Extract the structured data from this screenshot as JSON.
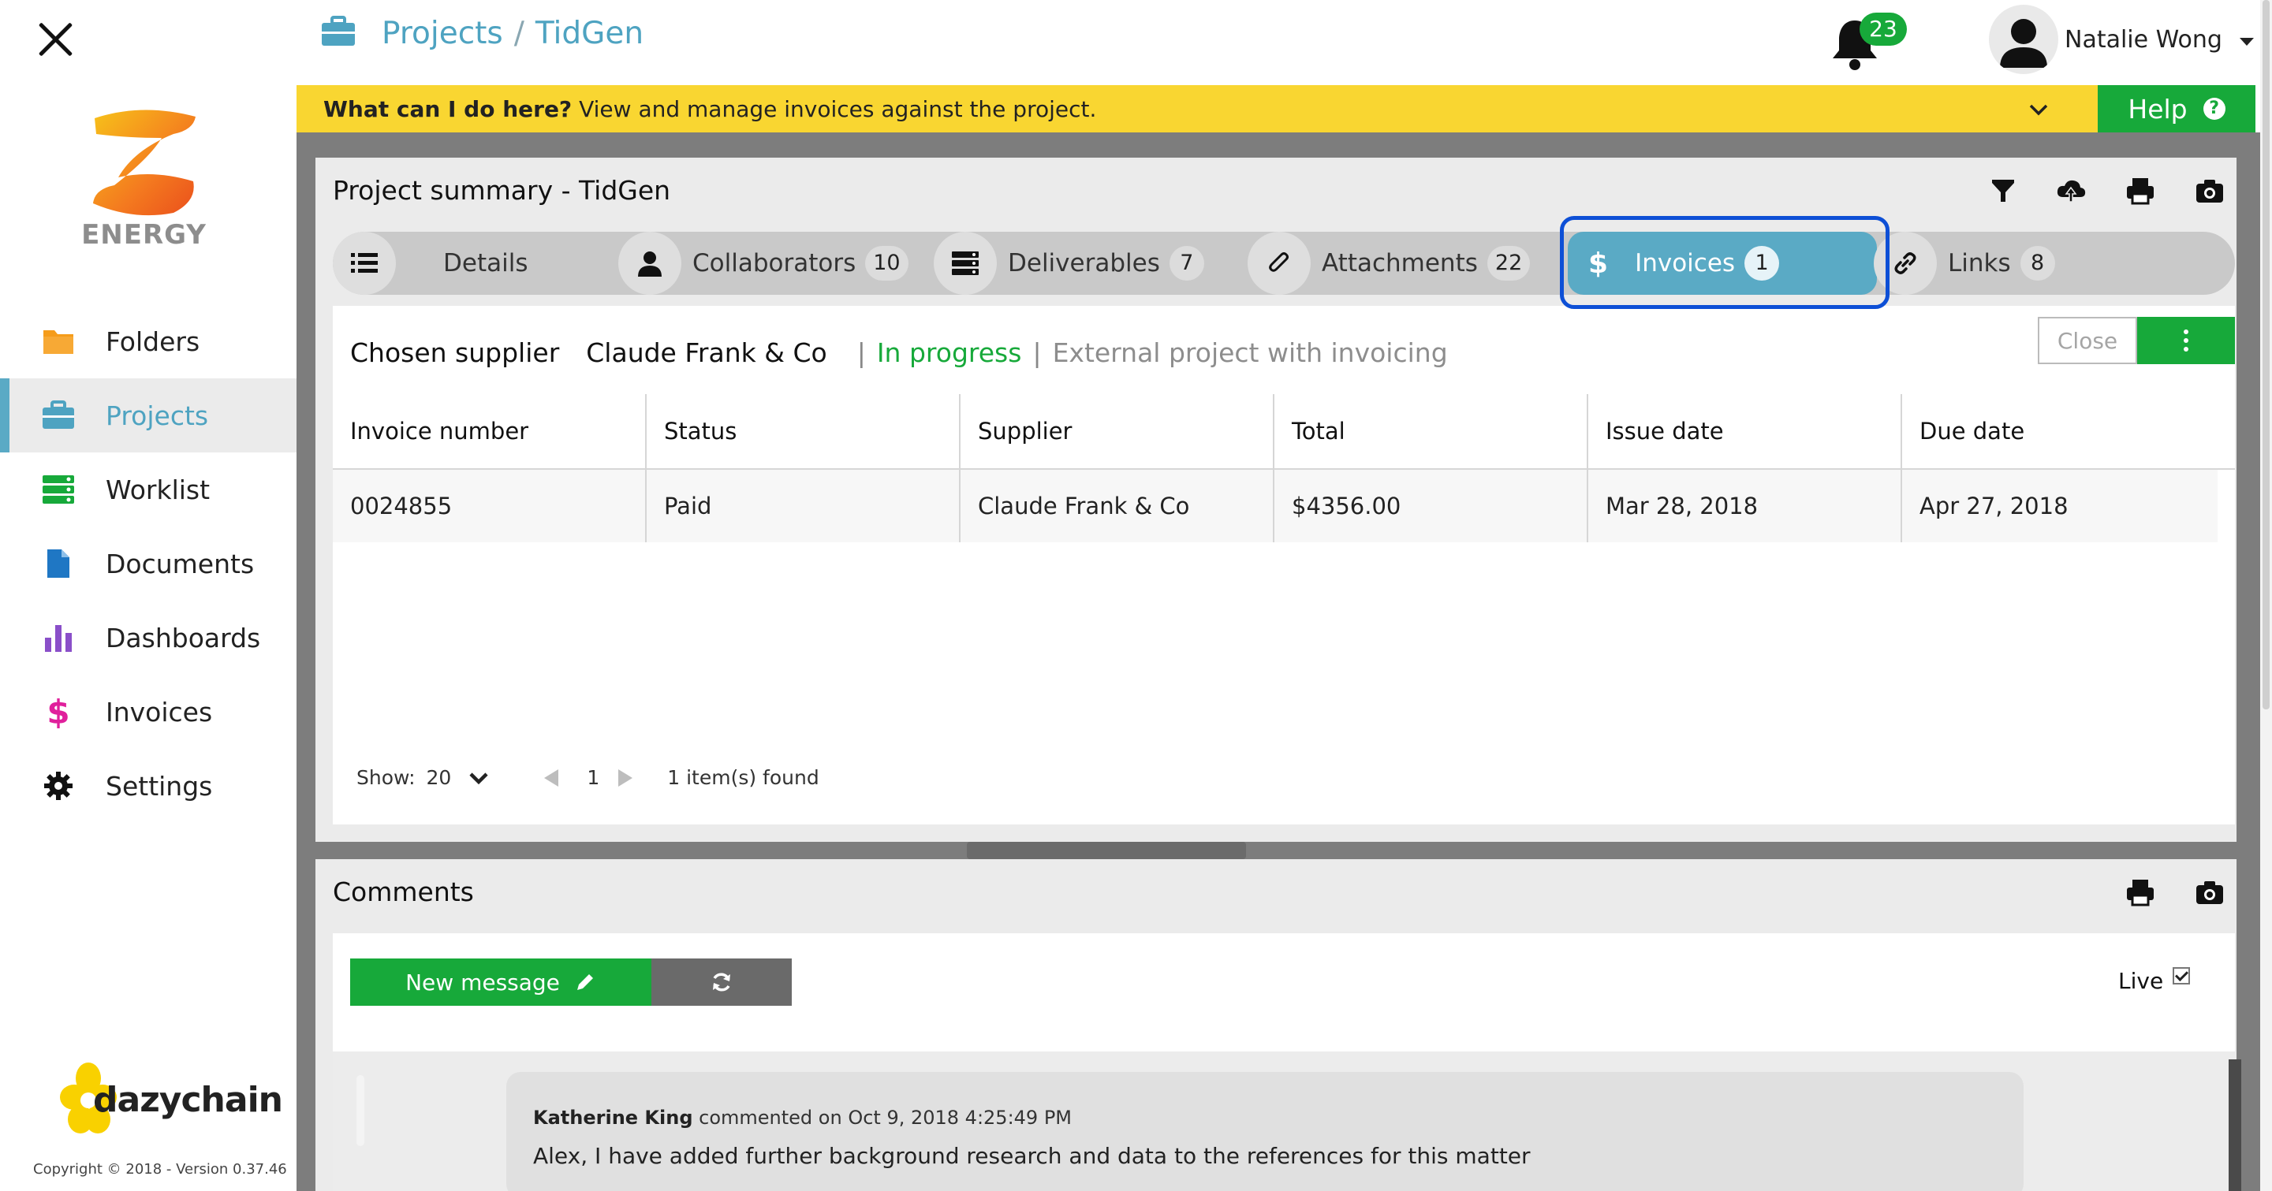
{
  "app": {
    "company_logo_text": "ENERGY",
    "brand_name": "dazychain",
    "copyright": "Copyright © 2018 - Version 0.37.46"
  },
  "sidebar": {
    "items": [
      {
        "label": "Folders",
        "icon": "folder-icon",
        "color": "#f59c1a",
        "active": false
      },
      {
        "label": "Projects",
        "icon": "briefcase-icon",
        "color": "#4ea3c1",
        "active": true
      },
      {
        "label": "Worklist",
        "icon": "list-icon",
        "color": "#17a93a",
        "active": false
      },
      {
        "label": "Documents",
        "icon": "document-icon",
        "color": "#1f77c4",
        "active": false
      },
      {
        "label": "Dashboards",
        "icon": "bar-chart-icon",
        "color": "#8a4fc9",
        "active": false
      },
      {
        "label": "Invoices",
        "icon": "dollar-icon",
        "color": "#e0209c",
        "active": false
      },
      {
        "label": "Settings",
        "icon": "gear-icon",
        "color": "#111111",
        "active": false
      }
    ]
  },
  "header": {
    "breadcrumb": [
      "Projects",
      "TidGen"
    ],
    "breadcrumb_separator": "/",
    "notifications_count": "23",
    "user_name": "Natalie Wong"
  },
  "help_banner": {
    "question": "What can I do here?",
    "text": "View and manage invoices against the project.",
    "help_label": "Help",
    "help_icon": "question-circle-icon"
  },
  "summary": {
    "title": "Project summary - TidGen",
    "tools": [
      "filter-icon",
      "cloud-upload-icon",
      "print-icon",
      "camera-icon"
    ],
    "tabs": [
      {
        "label": "Details",
        "count": "",
        "icon": "list-icon"
      },
      {
        "label": "Collaborators",
        "count": "10",
        "icon": "user-icon"
      },
      {
        "label": "Deliverables",
        "count": "7",
        "icon": "server-icon"
      },
      {
        "label": "Attachments",
        "count": "22",
        "icon": "paperclip-icon"
      },
      {
        "label": "Invoices",
        "count": "1",
        "icon": "dollar-icon",
        "active": true
      },
      {
        "label": "Links",
        "count": "8",
        "icon": "link-icon"
      }
    ],
    "supplier_label": "Chosen supplier",
    "supplier_name": "Claude Frank & Co",
    "status": "In progress",
    "project_type": "External project with invoicing",
    "close_label": "Close",
    "table": {
      "columns": [
        "Invoice number",
        "Status",
        "Supplier",
        "Total",
        "Issue date",
        "Due date"
      ],
      "rows": [
        [
          "0024855",
          "Paid",
          "Claude Frank & Co",
          "$4356.00",
          "Mar 28, 2018",
          "Apr 27, 2018"
        ]
      ]
    },
    "pager": {
      "show_label": "Show:",
      "page_size": "20",
      "page": "1",
      "found": "1 item(s) found"
    }
  },
  "comments": {
    "title": "Comments",
    "tools": [
      "print-icon",
      "camera-icon"
    ],
    "new_message_label": "New message",
    "live_label": "Live",
    "live_checked": true,
    "items": [
      {
        "author": "Katherine King",
        "meta": "commented on Oct 9, 2018 4:25:49 PM",
        "text": "Alex, I have added further background research and data to the references for this matter"
      }
    ]
  },
  "colors": {
    "accent": "#4ea3c1",
    "green": "#17a93a",
    "banner": "#f9d631",
    "highlight": "#0d4fd6"
  }
}
